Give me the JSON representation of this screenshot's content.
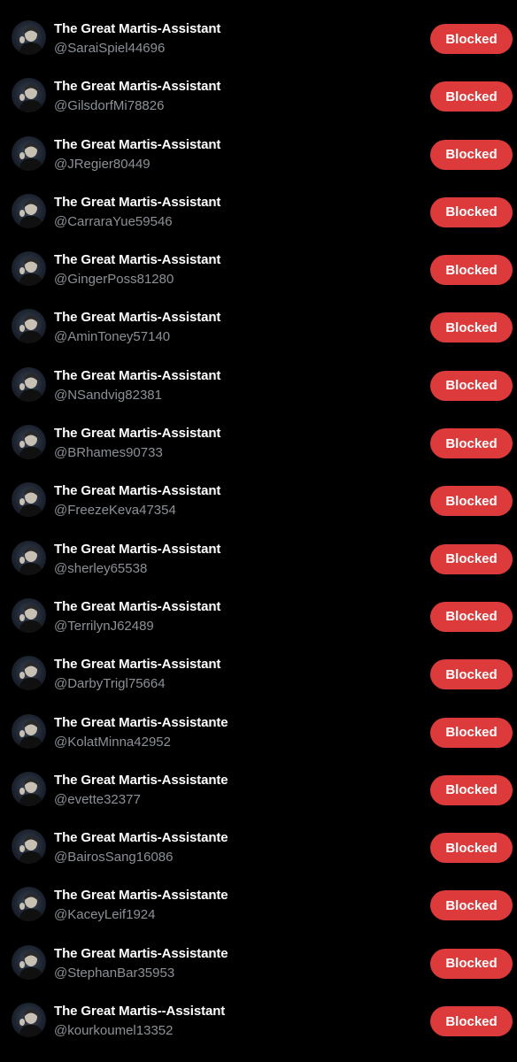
{
  "blocked_list": {
    "button_color": "#dc3a3b",
    "users": [
      {
        "display_name": "The Great Martis-Assistant",
        "handle": "@SaraiSpiel44696",
        "status_label": "Blocked"
      },
      {
        "display_name": "The Great Martis-Assistant",
        "handle": "@GilsdorfMi78826",
        "status_label": "Blocked"
      },
      {
        "display_name": "The Great Martis-Assistant",
        "handle": "@JRegier80449",
        "status_label": "Blocked"
      },
      {
        "display_name": "The Great Martis-Assistant",
        "handle": "@CarraraYue59546",
        "status_label": "Blocked"
      },
      {
        "display_name": "The Great Martis-Assistant",
        "handle": "@GingerPoss81280",
        "status_label": "Blocked"
      },
      {
        "display_name": "The Great Martis-Assistant",
        "handle": "@AminToney57140",
        "status_label": "Blocked"
      },
      {
        "display_name": "The Great Martis-Assistant",
        "handle": "@NSandvig82381",
        "status_label": "Blocked"
      },
      {
        "display_name": "The Great Martis-Assistant",
        "handle": "@BRhames90733",
        "status_label": "Blocked"
      },
      {
        "display_name": "The Great Martis-Assistant",
        "handle": "@FreezeKeva47354",
        "status_label": "Blocked"
      },
      {
        "display_name": "The Great Martis-Assistant",
        "handle": "@sherley65538",
        "status_label": "Blocked"
      },
      {
        "display_name": "The Great Martis-Assistant",
        "handle": "@TerrilynJ62489",
        "status_label": "Blocked"
      },
      {
        "display_name": "The Great Martis-Assistant",
        "handle": "@DarbyTrigl75664",
        "status_label": "Blocked"
      },
      {
        "display_name": "The Great Martis-Assistante",
        "handle": "@KolatMinna42952",
        "status_label": "Blocked"
      },
      {
        "display_name": "The Great Martis-Assistante",
        "handle": "@evette32377",
        "status_label": "Blocked"
      },
      {
        "display_name": "The Great Martis-Assistante",
        "handle": "@BairosSang16086",
        "status_label": "Blocked"
      },
      {
        "display_name": "The Great Martis-Assistante",
        "handle": "@KaceyLeif1924",
        "status_label": "Blocked"
      },
      {
        "display_name": "The Great Martis-Assistante",
        "handle": "@StephanBar35953",
        "status_label": "Blocked"
      },
      {
        "display_name": "The Great Martis--Assistant",
        "handle": "@kourkoumel13352",
        "status_label": "Blocked"
      }
    ]
  }
}
